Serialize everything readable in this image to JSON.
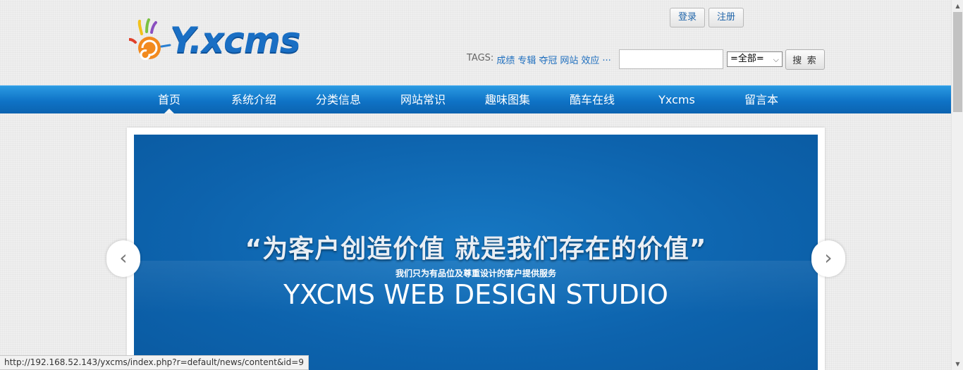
{
  "header": {
    "logo_text": "Y.xcms",
    "login_label": "登录",
    "register_label": "注册",
    "tags_label": "TAGS:",
    "tags": [
      "成绩",
      "专辑",
      "夺冠",
      "网站",
      "效应",
      "..."
    ],
    "search": {
      "value": "",
      "select_value": "=全部=",
      "button_label": "搜 索"
    }
  },
  "nav": {
    "items": [
      "首页",
      "系统介绍",
      "分类信息",
      "网站常识",
      "趣味图集",
      "酷车在线",
      "Yxcms",
      "留言本"
    ],
    "active_index": 0
  },
  "banner": {
    "slogan": "“为客户创造价值  就是我们存在的价值”",
    "subline": "我们只为有品位及尊重设计的客户提供服务",
    "studio": "YXCMS WEB DESIGN STUDIO",
    "prev_icon": "‹",
    "next_icon": "›"
  },
  "status_bar": {
    "url": "http://192.168.52.143/yxcms/index.php?r=default/news/content&id=9"
  },
  "colors": {
    "nav_blue": "#1780cf",
    "banner_blue": "#0d63ad",
    "link_blue": "#1f6fbf"
  }
}
